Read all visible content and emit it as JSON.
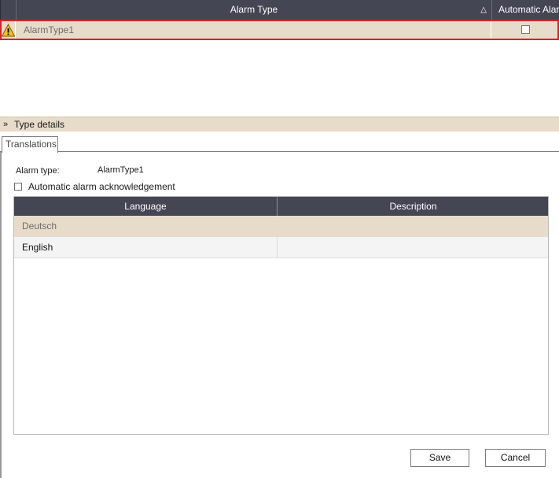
{
  "alarm_grid": {
    "col_alarm_type": "Alarm Type",
    "col_automatic": "Automatic Alar",
    "sort_icon": "sort-ascending-icon",
    "rows": [
      {
        "name": "AlarmType1",
        "icon": "warning-icon",
        "automatic": false
      }
    ]
  },
  "details": {
    "title": "Type details",
    "collapse_icon": "double-chevron-up-icon",
    "tabs": [
      {
        "label": "Translations"
      }
    ],
    "alarm_type_label": "Alarm type:",
    "alarm_type_value": "AlarmType1",
    "auto_ack_label": "Automatic alarm acknowledgement",
    "auto_ack_checked": false
  },
  "translations": {
    "col_language": "Language",
    "col_description": "Description",
    "rows": [
      {
        "language": "Deutsch",
        "description": ""
      },
      {
        "language": "English",
        "description": ""
      }
    ]
  },
  "buttons": {
    "save": "Save",
    "cancel": "Cancel"
  },
  "colors": {
    "header_bg": "#454654",
    "selected_row": "#e7dcc9",
    "selection_border": "#d6222d"
  }
}
